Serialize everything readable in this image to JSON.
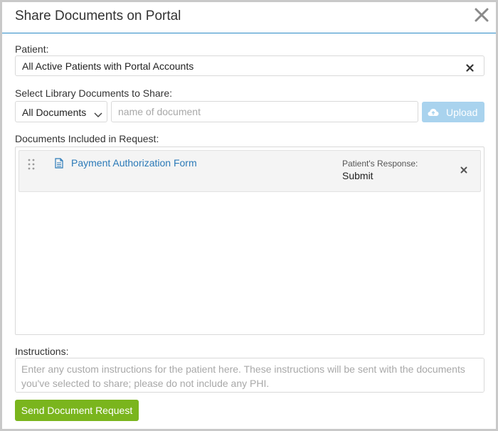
{
  "dialog": {
    "title": "Share Documents on Portal"
  },
  "patient": {
    "label": "Patient:",
    "value": "All Active Patients with Portal Accounts"
  },
  "library": {
    "label": "Select Library Documents to Share:",
    "filter_selected": "All Documents",
    "search_placeholder": "name of document",
    "upload_label": "Upload"
  },
  "included": {
    "label": "Documents Included in Request:",
    "items": [
      {
        "name": "Payment Authorization Form",
        "response_label": "Patient's Response:",
        "response_value": "Submit"
      }
    ]
  },
  "instructions": {
    "label": "Instructions:",
    "placeholder": "Enter any custom instructions for the patient here. These instructions will be sent with the documents you've selected to share; please do not include any PHI."
  },
  "actions": {
    "send_label": "Send Document Request"
  },
  "colors": {
    "accent_blue": "#2b8ac6",
    "link_blue": "#2b7ab8",
    "upload_disabled": "#a9d3ee",
    "send_green": "#7ab51d"
  },
  "icons": [
    "close-icon",
    "clear-icon",
    "chevron-down-icon",
    "cloud-upload-icon",
    "drag-handle-icon",
    "document-icon",
    "remove-icon"
  ]
}
